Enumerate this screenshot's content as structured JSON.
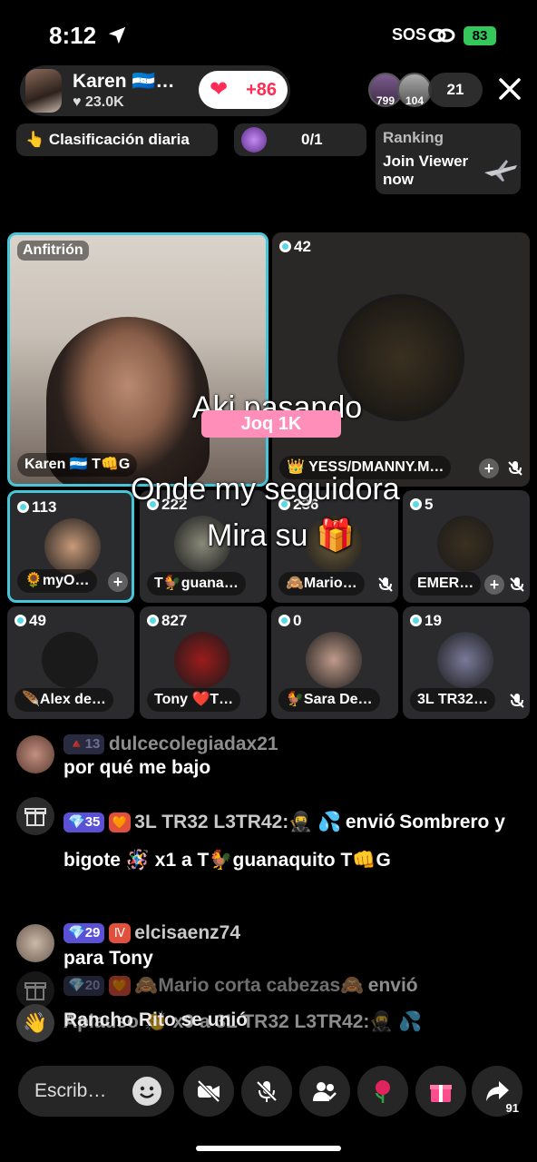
{
  "status_bar": {
    "time": "8:12",
    "sos": "SOS",
    "battery": "83"
  },
  "header": {
    "host_name": "Karen 🇭🇳…",
    "host_likes": "♥ 23.0K",
    "plus_count": "+86",
    "viewer_avatars": [
      "799",
      "104"
    ],
    "viewer_count": "21"
  },
  "rank": {
    "daily_label": "👆 Clasificación diaria",
    "goal": "0/1",
    "ranking_title": "Ranking",
    "ranking_subtitle": "Join Viewer now"
  },
  "host_tile": {
    "badge": "Anfitrión",
    "name": "Karen 🇭🇳 T👊G"
  },
  "big_tile": {
    "count": "42",
    "name": "👑 YESS/DMANNY.M…"
  },
  "grid": [
    {
      "count": "113",
      "name": "🌻myO…",
      "has_add": true,
      "muted": false,
      "selected": true,
      "avatar_color": "#c89a7a"
    },
    {
      "count": "222",
      "name": "T🐓guana…",
      "has_add": false,
      "muted": false,
      "selected": false,
      "avatar_color": "#8a8a7a"
    },
    {
      "count": "236",
      "name": "🙈Mario…",
      "has_add": false,
      "muted": true,
      "selected": false,
      "avatar_color": "#6a5a3a"
    },
    {
      "count": "5",
      "name": "EMER…",
      "has_add": true,
      "muted": true,
      "selected": false,
      "avatar_color": "#3b3020"
    },
    {
      "count": "49",
      "name": "🪶Alex de…",
      "has_add": false,
      "muted": false,
      "selected": false,
      "avatar_color": "#1a1a1a"
    },
    {
      "count": "827",
      "name": "Tony ❤️T…",
      "has_add": false,
      "muted": false,
      "selected": false,
      "avatar_color": "#9b1b1b"
    },
    {
      "count": "0",
      "name": "🐓Sara De…",
      "has_add": false,
      "muted": false,
      "selected": false,
      "avatar_color": "#c09a8a"
    },
    {
      "count": "19",
      "name": "3L TR32…",
      "has_add": false,
      "muted": true,
      "selected": false,
      "avatar_color": "#7a7a9a"
    }
  ],
  "overlay": {
    "line1": "Aki pasando",
    "chip": "Joq 1K",
    "line2": "Onde my seguidora",
    "line3": "Mira su 🎁"
  },
  "chat": [
    {
      "level": "13",
      "user": "dulcecolegiadax21",
      "message": "por qué me bajo"
    },
    {
      "level": "35",
      "user": "3L TR32 L3TR42:🥷 💦",
      "action": "envió",
      "message": "Sombrero y bigote 🪅 x1 a T🐓guanaquito T👊G"
    },
    {
      "level": "29",
      "user": "elcisaenz74",
      "message": "para Tony"
    },
    {
      "level": "20",
      "user": "🙈Mario corta  cabezas🙈",
      "action": "envió",
      "message": "Aplauso 👏 x9 a 3L TR32 L3TR42:🥷 💦"
    },
    {
      "message": "Rancho Rito se unió"
    }
  ],
  "bottom": {
    "placeholder": "Escrib…",
    "share_count": "91"
  }
}
